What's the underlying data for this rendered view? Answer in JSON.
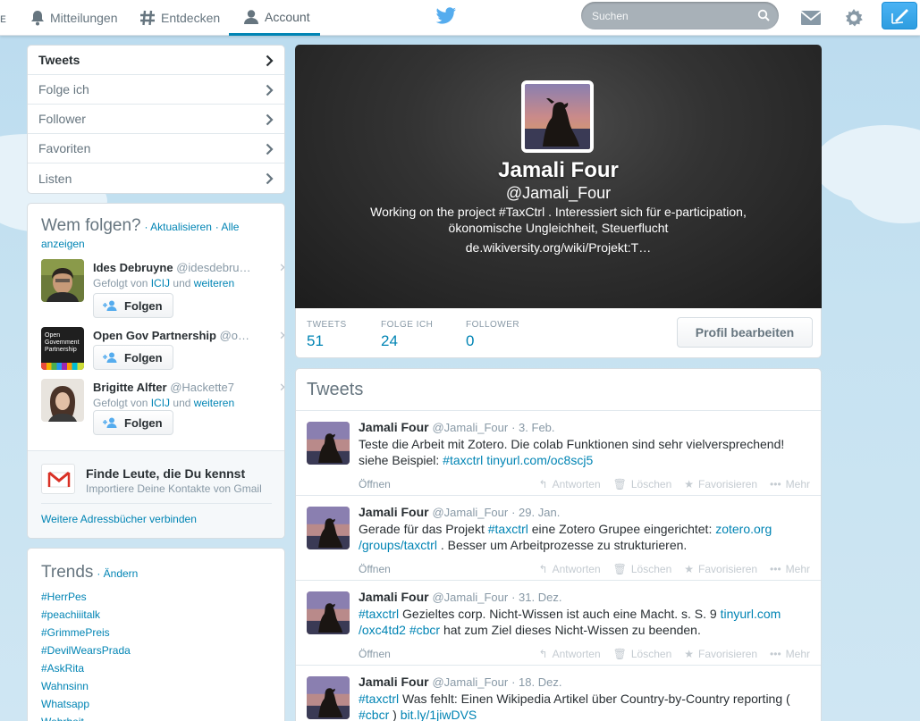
{
  "nav": {
    "items": [
      {
        "label": "Mitteilungen",
        "icon": "bell-icon"
      },
      {
        "label": "Entdecken",
        "icon": "hash-icon"
      },
      {
        "label": "Account",
        "icon": "person-icon",
        "active": true
      }
    ],
    "search_placeholder": "Suchen",
    "brand": "twitter-bird-icon",
    "accent": "#0084b4"
  },
  "profile_menu": {
    "items": [
      {
        "label": "Tweets",
        "active": true
      },
      {
        "label": "Folge ich"
      },
      {
        "label": "Follower"
      },
      {
        "label": "Favoriten"
      },
      {
        "label": "Listen"
      }
    ]
  },
  "who_to_follow": {
    "title": "Wem folgen?",
    "refresh": "· Aktualisieren",
    "view_all": "· Alle anzeigen",
    "suggestions": [
      {
        "name": "Ides Debruyne",
        "handle": "@idesdebru…",
        "followed_by_prefix": "Gefolgt von",
        "followed_by": "ICIJ",
        "and": "und",
        "more": "weiteren",
        "button": "Folgen"
      },
      {
        "name": "Open Gov Partnership",
        "handle": "@o…",
        "button": "Folgen",
        "avatar_text": "Open Government Partnership"
      },
      {
        "name": "Brigitte Alfter",
        "handle": "@Hackette7",
        "followed_by_prefix": "Gefolgt von",
        "followed_by": "ICIJ",
        "and": "und",
        "more": "weiteren",
        "button": "Folgen"
      }
    ],
    "find_people_title": "Finde Leute, die Du kennst",
    "find_people_sub": "Importiere Deine Kontakte von Gmail",
    "more_books": "Weitere Adressbücher verbinden"
  },
  "trends": {
    "title": "Trends",
    "change": "· Ändern",
    "items": [
      "#HerrPes",
      "#peachiiitalk",
      "#GrimmePreis",
      "#DevilWearsPrada",
      "#AskRita",
      "Wahnsinn",
      "Whatsapp",
      "Wehrheit"
    ]
  },
  "profile": {
    "name": "Jamali Four",
    "handle": "@Jamali_Four",
    "bio": "Working on the project #TaxCtrl . Interessiert sich für e-participation, ökonomische Ungleichheit, Steuerflucht",
    "url": "de.wikiversity.org/wiki/Projekt:T…",
    "stats": [
      {
        "label": "TWEETS",
        "value": "51"
      },
      {
        "label": "FOLGE ICH",
        "value": "24"
      },
      {
        "label": "FOLLOWER",
        "value": "0"
      }
    ],
    "edit_button": "Profil bearbeiten"
  },
  "tweets": {
    "title": "Tweets",
    "actions": {
      "reply": "Antworten",
      "delete": "Löschen",
      "favorite": "Favorisieren",
      "more": "Mehr",
      "open": "Öffnen"
    },
    "items": [
      {
        "name": "Jamali Four",
        "handle": "@Jamali_Four",
        "date": "· 3. Feb.",
        "t1": "Teste die Arbeit mit Zotero. Die colab Funktionen sind sehr vielversprechend!",
        "t2": "siehe Beispiel: ",
        "l1": "#taxctrl",
        "l2": "tinyurl.com/oc8scj5"
      },
      {
        "name": "Jamali Four",
        "handle": "@Jamali_Four",
        "date": "· 29. Jan.",
        "t1": "Gerade für das Projekt ",
        "l1": "#taxctrl",
        "t2": " eine Zotero Grupee eingerichtet: ",
        "l2": "zotero.org",
        "l3": "/groups/taxctrl",
        "t3": " . Besser um Arbeitprozesse zu strukturieren."
      },
      {
        "name": "Jamali Four",
        "handle": "@Jamali_Four",
        "date": "· 31. Dez.",
        "l1": "#taxctrl",
        "t1": " Gezieltes corp. Nicht-Wissen ist auch eine Macht. s. S. 9 ",
        "l2": "tinyurl.com",
        "l3": "/oxc4td2",
        "l4": "#cbcr",
        "t2": " hat zum Ziel dieses Nicht-Wissen zu beenden."
      },
      {
        "name": "Jamali Four",
        "handle": "@Jamali_Four",
        "date": "· 18. Dez.",
        "l1": "#taxctrl",
        "t1": " Was fehlt: Einen Wikipedia Artikel über Country-by-Country reporting (",
        "l2": "#cbcr",
        "t2": " ) ",
        "l3": "bit.ly/1jiwDVS"
      }
    ]
  }
}
